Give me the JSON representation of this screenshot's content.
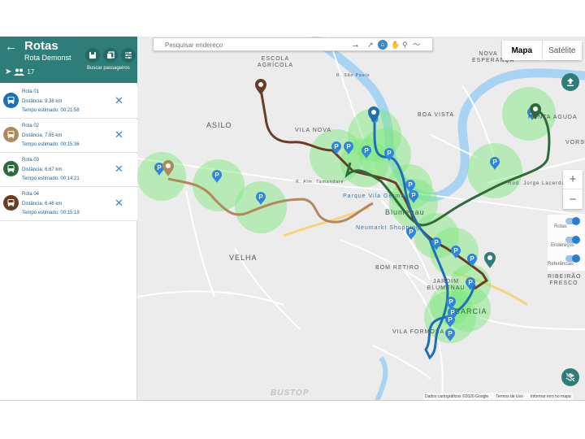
{
  "sidebar": {
    "back_icon": "arrow-left-icon",
    "title": "Rotas",
    "subtitle": "Rota Demonst",
    "actions_label": "Buscar passageiros",
    "passenger_count": "17",
    "routes": [
      {
        "name": "Rota 01",
        "distance": "Distância: 9.38 km",
        "time": "Tempo estimado: 00:21:58",
        "color": "#1f6fb5"
      },
      {
        "name": "Rota 02",
        "distance": "Distância: 7.85 km",
        "time": "Tempo estimado: 00:15:36",
        "color": "#b08a5e"
      },
      {
        "name": "Rota 03",
        "distance": "Distância: 6.67 km",
        "time": "Tempo estimado: 00:14:21",
        "color": "#2f6a3a"
      },
      {
        "name": "Rota 04",
        "distance": "Distância: 6.46 km",
        "time": "Tempo estimado: 00:15:19",
        "color": "#6b3b26"
      }
    ]
  },
  "map": {
    "search": {
      "placeholder": "Pesquisar endereço"
    },
    "map_type": {
      "map": "Mapa",
      "satellite": "Satélite"
    },
    "zoom": {
      "in": "+",
      "out": "−"
    },
    "layer_toggles": [
      {
        "label": "Rotas",
        "on": true
      },
      {
        "label": "Endereços",
        "on": true
      },
      {
        "label": "Referências",
        "on": true
      }
    ],
    "place_labels": [
      {
        "text": "ESCOLA AGRÍCOLA",
        "key": "escola"
      },
      {
        "text": "ASILO",
        "key": "asilo"
      },
      {
        "text": "VILA NOVA",
        "key": "vilanova"
      },
      {
        "text": "BOA VISTA",
        "key": "boavista"
      },
      {
        "text": "PONTA AGUDA",
        "key": "pontaaguda"
      },
      {
        "text": "NOVA ESPERANÇA",
        "key": "novaesp"
      },
      {
        "text": "VORST",
        "key": "vorst"
      },
      {
        "text": "VELHA",
        "key": "velha"
      },
      {
        "text": "Blumenau",
        "key": "blumenau"
      },
      {
        "text": "Parque Vila Germânica",
        "key": "parque"
      },
      {
        "text": "Neumarkt Shopping",
        "key": "neumarkt"
      },
      {
        "text": "BOM RETIRO",
        "key": "bomretiro"
      },
      {
        "text": "JARDIM BLUMENAU",
        "key": "jardim"
      },
      {
        "text": "GARCIA",
        "key": "garcia"
      },
      {
        "text": "VILA FORMOSA",
        "key": "vilaformosa"
      },
      {
        "text": "RIBEIRÃO FRESCO",
        "key": "ribeirao"
      },
      {
        "text": "Rod. Jorge Lacerda",
        "key": "rodjorge"
      },
      {
        "text": "R. Alm. Tamandaré",
        "key": "tamandare"
      },
      {
        "text": "R. São Paulo",
        "key": "saopaulo"
      }
    ],
    "watermark": "BUSTOP",
    "footer": {
      "data": "Dados cartográficos ©2020 Google",
      "terms": "Termos de Uso",
      "report": "Informar erro no mapa"
    }
  },
  "colors": {
    "header": "#2f7d78",
    "route1": "#1f6fb5",
    "route2": "#b08a5e",
    "route3": "#2f6a3a",
    "route4": "#6b3b26",
    "coverage": "#7be87a",
    "river": "#a9d3f2"
  }
}
